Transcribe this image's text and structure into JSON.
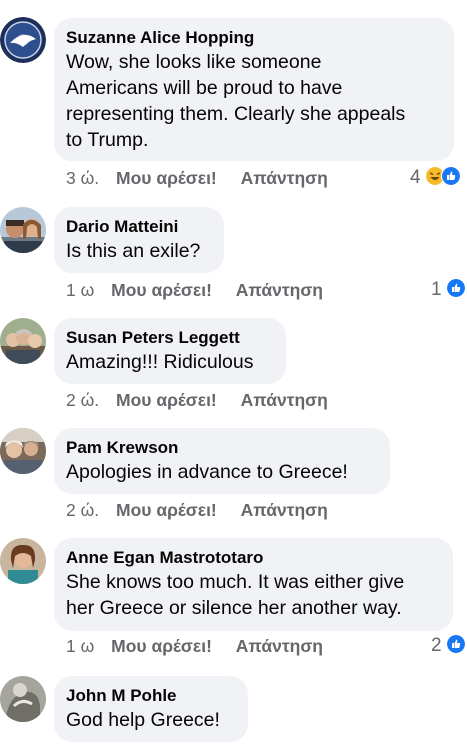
{
  "ui": {
    "like_label": "Μου αρέσει!",
    "reply_label": "Απάντηση",
    "colors": {
      "bubble": "#f0f2f5",
      "like_blue": "#1877f2",
      "meta_gray": "#65676b",
      "text": "#050505"
    }
  },
  "comments": [
    {
      "author": "Suzanne Alice Hopping",
      "text": "Wow, she looks like someone Americans will be proud to have representing them. Clearly she appeals to Trump.",
      "lines": [
        "Wow, she looks like someone",
        "Americans will be proud to have",
        "representing them. Clearly she appeals",
        "to Trump."
      ],
      "time": "3 ώ.",
      "reaction_count": "4",
      "reactions": [
        "haha-icon",
        "like-icon"
      ]
    },
    {
      "author": "Dario Matteini",
      "text": "Is this an exile?",
      "lines": [
        "Is this an exile?"
      ],
      "time": "1 ω",
      "reaction_count": "1",
      "reactions": [
        "like-icon"
      ]
    },
    {
      "author": "Susan Peters Leggett",
      "text": "Amazing!!! Ridiculous",
      "lines": [
        "Amazing!!! Ridiculous"
      ],
      "time": "2 ώ."
    },
    {
      "author": "Pam Krewson",
      "text": "Apologies in advance to Greece!",
      "lines": [
        "Apologies in advance to Greece!"
      ],
      "time": "2 ώ."
    },
    {
      "author": "Anne Egan Mastrototaro",
      "text": "She knows too much. It was either give her Greece or silence her another way.",
      "lines": [
        "She knows too much. It was either give",
        "her Greece or silence her another way."
      ],
      "time": "1 ω",
      "reaction_count": "2",
      "reactions": [
        "like-icon"
      ]
    },
    {
      "author": "John M Pohle",
      "text": "God help Greece!",
      "lines": [
        "God help Greece!"
      ]
    }
  ]
}
